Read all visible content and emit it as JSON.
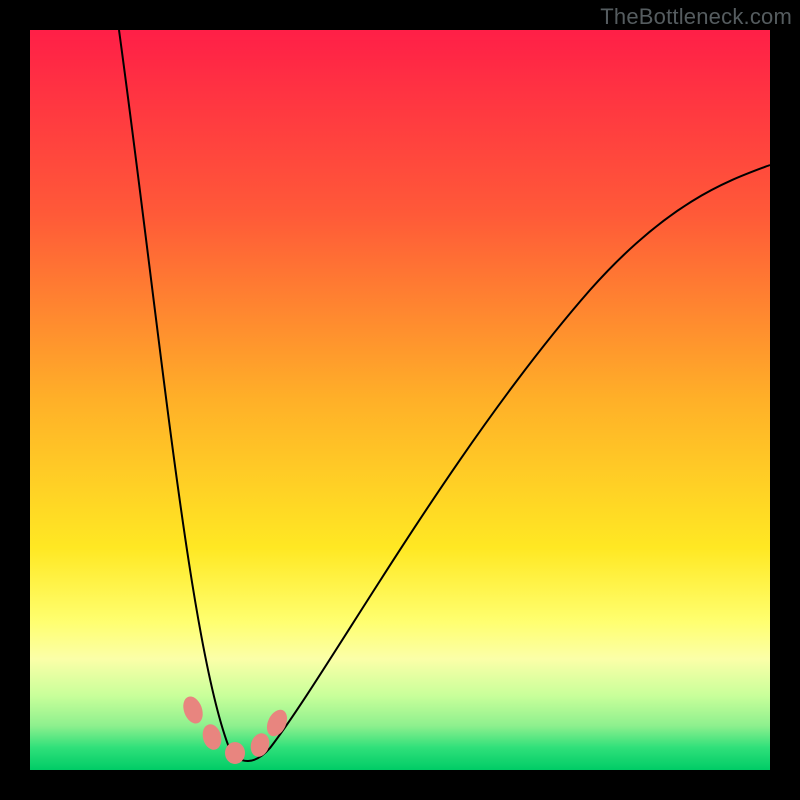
{
  "watermark": "TheBottleneck.com",
  "chart_data": {
    "type": "line",
    "title": "",
    "xlabel": "",
    "ylabel": "",
    "xlim": [
      0,
      100
    ],
    "ylim": [
      0,
      100
    ],
    "legend": false,
    "grid": false,
    "background_gradient": {
      "top": "#ff1f47",
      "mid": "#ffe823",
      "bottom": "#00cc66"
    },
    "curve": {
      "description": "V-shaped bottleneck curve; minimum near x≈27, rising steeply to left edge and moderately to right edge",
      "min_x": 27,
      "min_y": 2,
      "left_top_x": 12,
      "left_top_y": 100,
      "right_end_x": 100,
      "right_end_y": 82
    },
    "markers": [
      {
        "x": 22,
        "y": 8
      },
      {
        "x": 25,
        "y": 4
      },
      {
        "x": 28,
        "y": 3
      },
      {
        "x": 31,
        "y": 5
      },
      {
        "x": 33,
        "y": 9
      }
    ],
    "marker_color": "#e8857f"
  }
}
